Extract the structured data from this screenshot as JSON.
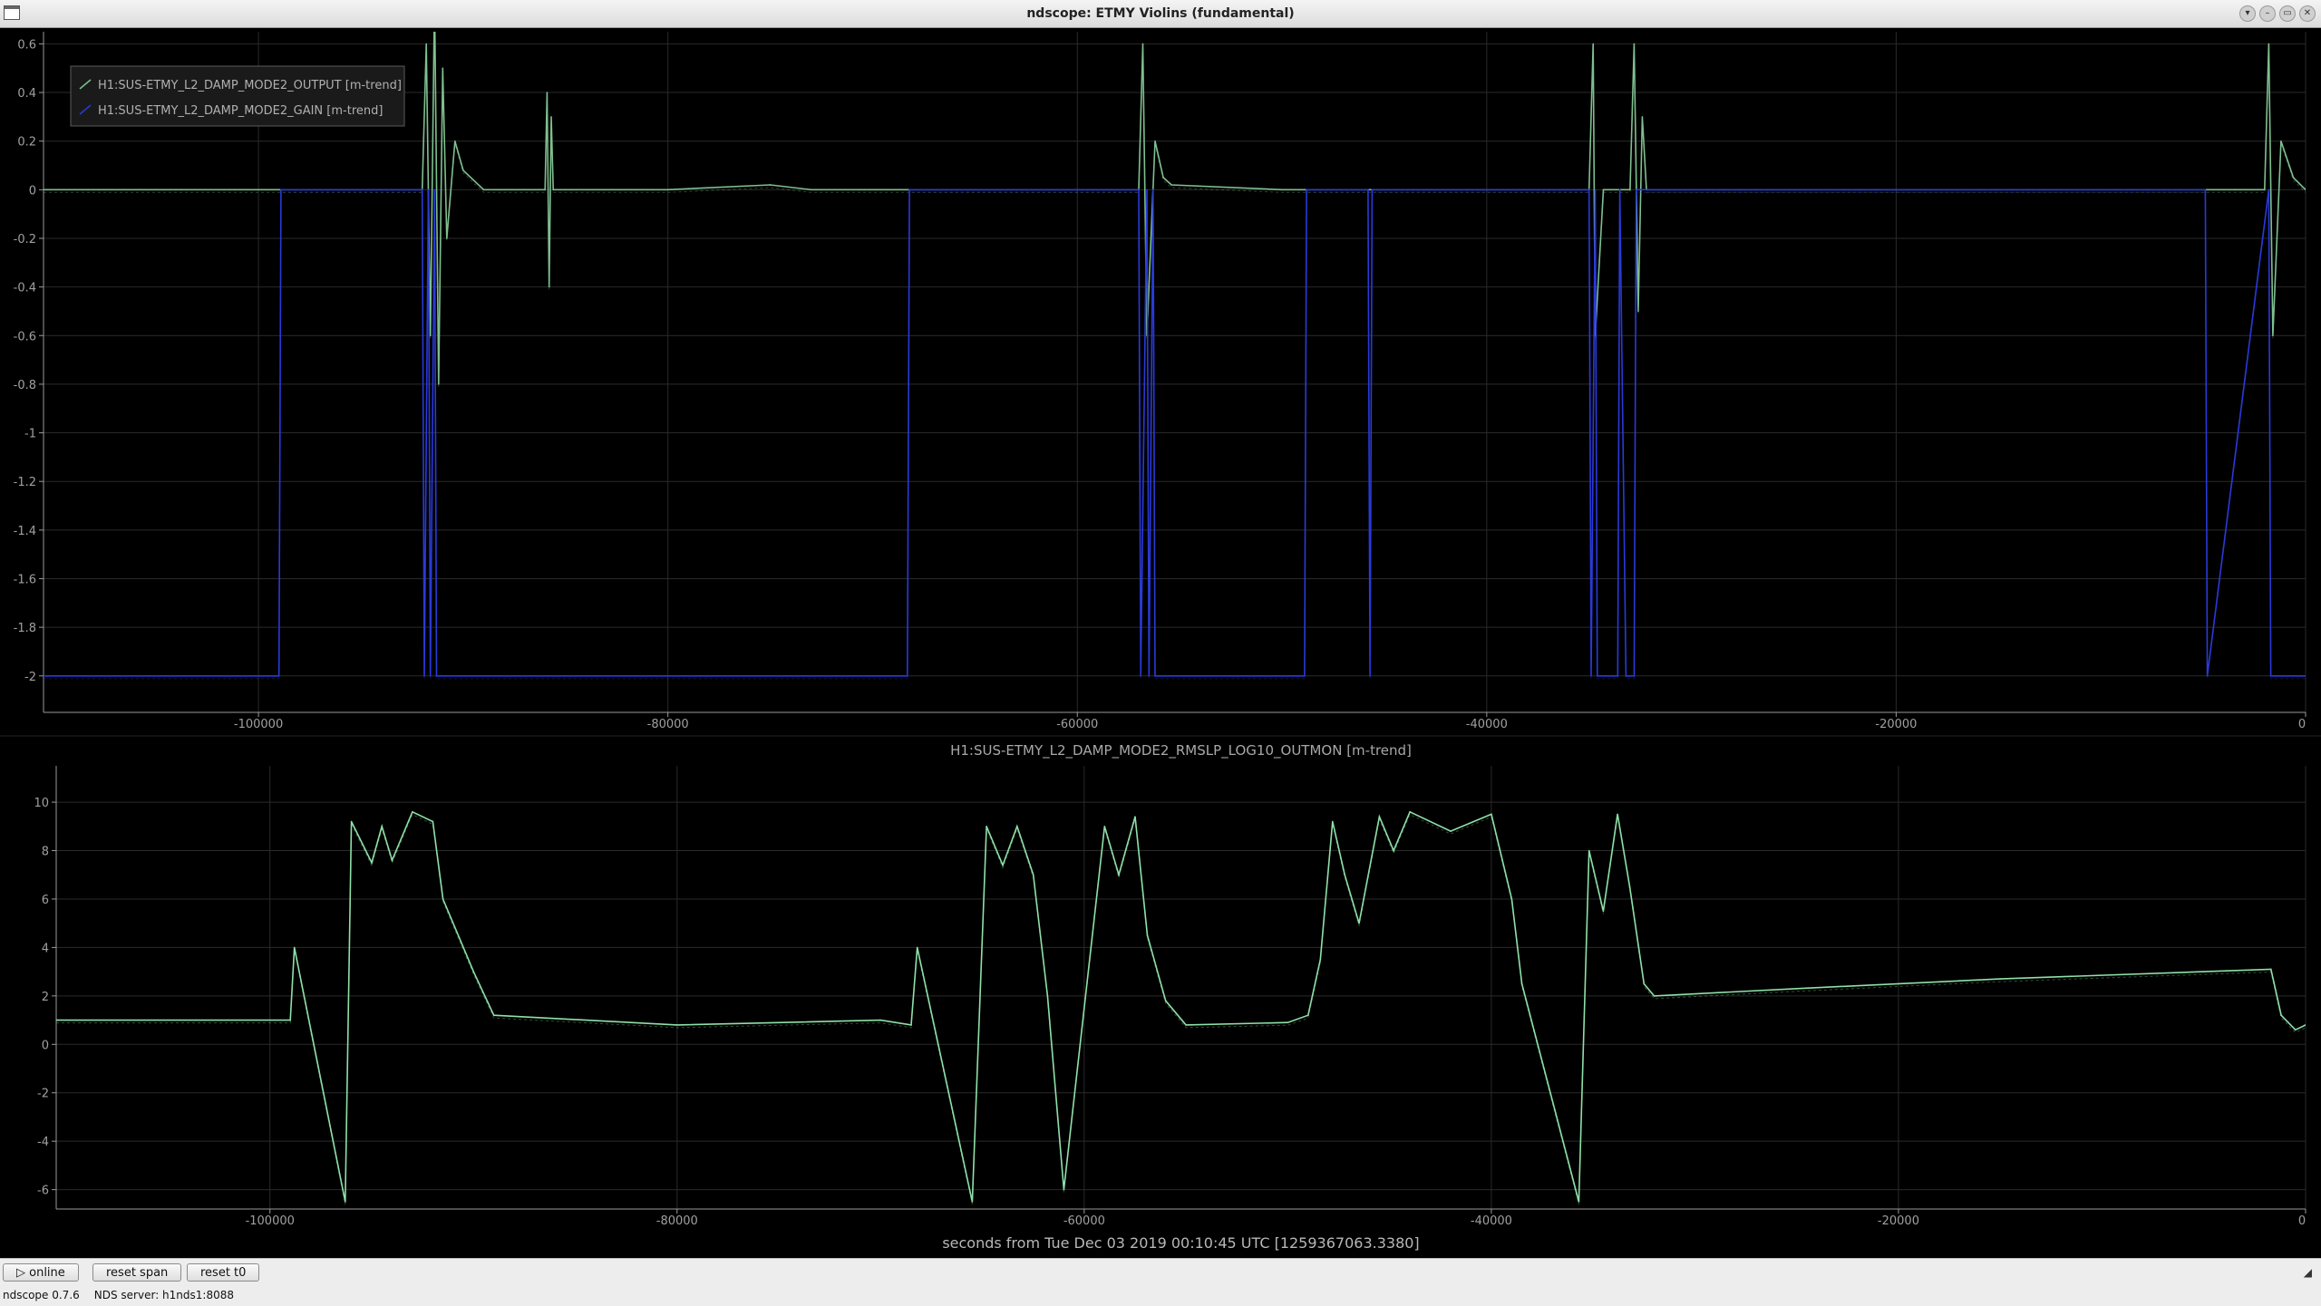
{
  "window": {
    "title": "ndscope: ETMY Violins (fundamental)",
    "buttons": [
      "▾",
      "–",
      "▭",
      "✕"
    ]
  },
  "colors": {
    "background": "#000000",
    "grid": "#2a2a2a",
    "axis": "#9a9a9a",
    "output_trace": "#7fbf8f",
    "gain_trace": "#2a3ad8",
    "outmon_trace": "#8fe0a8"
  },
  "chart_data": [
    {
      "type": "line",
      "title": "",
      "xlabel": "",
      "ylabel": "",
      "xlim": [
        -110500,
        0
      ],
      "ylim": [
        -2.15,
        0.65
      ],
      "xticks": [
        -100000,
        -80000,
        -60000,
        -40000,
        -20000,
        0
      ],
      "yticks": [
        0.6,
        0.4,
        0.2,
        0,
        -0.2,
        -0.4,
        -0.6,
        -0.8,
        -1,
        -1.2,
        -1.4,
        -1.6,
        -1.8,
        -2
      ],
      "grid": true,
      "legend": "top-left",
      "series": [
        {
          "name": "H1:SUS-ETMY_L2_DAMP_MODE2_OUTPUT [m-trend]",
          "color": "#7fbf8f",
          "x": [
            -110500,
            -99000,
            -98900,
            -92000,
            -91800,
            -91600,
            -91400,
            -91200,
            -91000,
            -90800,
            -90400,
            -90000,
            -89000,
            -86000,
            -85900,
            -85800,
            -85700,
            -85600,
            -80000,
            -75000,
            -73000,
            -68500,
            -68400,
            -57000,
            -56800,
            -56600,
            -56200,
            -55800,
            -55400,
            -50000,
            -49100,
            -45800,
            -45600,
            -35000,
            -34800,
            -34700,
            -34300,
            -33000,
            -32800,
            -32600,
            -32400,
            -32200,
            -2000,
            -1800,
            -1600,
            -1200,
            -600,
            0
          ],
          "y": [
            0.0,
            0.0,
            0.0,
            0.0,
            0.6,
            -0.6,
            0.8,
            -0.8,
            0.5,
            -0.2,
            0.2,
            0.08,
            0.0,
            0.0,
            0.4,
            -0.4,
            0.3,
            0.0,
            0.0,
            0.02,
            0.0,
            0.0,
            0.0,
            0.0,
            0.6,
            -0.6,
            0.2,
            0.05,
            0.02,
            0.0,
            0.0,
            0.0,
            0.0,
            0.0,
            0.6,
            -0.6,
            0.0,
            0.0,
            0.6,
            -0.5,
            0.3,
            0.0,
            0.0,
            0.6,
            -0.6,
            0.2,
            0.05,
            0.0
          ]
        },
        {
          "name": "H1:SUS-ETMY_L2_DAMP_MODE2_GAIN [m-trend]",
          "color": "#2a3ad8",
          "x": [
            -110500,
            -99000,
            -98900,
            -92000,
            -91900,
            -91700,
            -91600,
            -91400,
            -91300,
            -91000,
            -90800,
            -68300,
            -68200,
            -57000,
            -56900,
            -56600,
            -56500,
            -56300,
            -56200,
            -48900,
            -48800,
            -45800,
            -45700,
            -45600,
            -35000,
            -34900,
            -34700,
            -34600,
            -33600,
            -33500,
            -33200,
            -32800,
            -32700,
            -4900,
            -4800,
            -1800,
            -1700,
            0
          ],
          "y": [
            -2,
            -2,
            0,
            0,
            -2,
            0,
            -2,
            0,
            -2,
            -2,
            -2,
            -2,
            0,
            0,
            -2,
            0,
            -2,
            0,
            -2,
            -2,
            0,
            0,
            -2,
            0,
            0,
            -2,
            0,
            -2,
            -2,
            0,
            -2,
            -2,
            0,
            0,
            -2,
            0,
            -2,
            -2
          ]
        }
      ]
    },
    {
      "type": "line",
      "title": "H1:SUS-ETMY_L2_DAMP_MODE2_RMSLP_LOG10_OUTMON [m-trend]",
      "xlabel": "seconds from Tue Dec 03 2019 00:10:45 UTC [1259367063.3380]",
      "ylabel": "",
      "xlim": [
        -110500,
        0
      ],
      "ylim": [
        -6.8,
        11.5
      ],
      "xticks": [
        -100000,
        -80000,
        -60000,
        -40000,
        -20000,
        0
      ],
      "yticks": [
        10,
        8,
        6,
        4,
        2,
        0,
        -2,
        -4,
        -6
      ],
      "grid": true,
      "legend": "none",
      "series": [
        {
          "name": "H1:SUS-ETMY_L2_DAMP_MODE2_RMSLP_LOG10_OUTMON [m-trend]",
          "color": "#8fe0a8",
          "x": [
            -110500,
            -99000,
            -98800,
            -96300,
            -96000,
            -95000,
            -94500,
            -94000,
            -93000,
            -92000,
            -91500,
            -90000,
            -89000,
            -80000,
            -70000,
            -68500,
            -68200,
            -65500,
            -64800,
            -64000,
            -63300,
            -62500,
            -61800,
            -61000,
            -59000,
            -58300,
            -57500,
            -56900,
            -56000,
            -55000,
            -50000,
            -49000,
            -48400,
            -47800,
            -47200,
            -46500,
            -45500,
            -44800,
            -44000,
            -42000,
            -40000,
            -39000,
            -38500,
            -35700,
            -35200,
            -34500,
            -33800,
            -33200,
            -32500,
            -32000,
            -25000,
            -15000,
            -5000,
            -1700,
            -1200,
            -500,
            0
          ],
          "y": [
            1.0,
            1.0,
            4.0,
            -6.5,
            9.2,
            7.5,
            9.0,
            7.6,
            9.6,
            9.2,
            6.0,
            3.0,
            1.2,
            0.8,
            1.0,
            0.8,
            4.0,
            -6.5,
            9.0,
            7.4,
            9.0,
            7.0,
            2.0,
            -6.0,
            9.0,
            7.0,
            9.4,
            4.5,
            1.8,
            0.8,
            0.9,
            1.2,
            3.5,
            9.2,
            7.0,
            5.0,
            9.4,
            8.0,
            9.6,
            8.8,
            9.5,
            6.0,
            2.5,
            -6.5,
            8.0,
            5.5,
            9.5,
            6.5,
            2.5,
            2.0,
            2.3,
            2.7,
            3.0,
            3.1,
            1.2,
            0.6,
            0.8
          ]
        }
      ]
    }
  ],
  "toolbar": {
    "online_label": "▷ online",
    "reset_span_label": "reset span",
    "reset_t0_label": "reset t0",
    "handle": "◢"
  },
  "status": {
    "version": "ndscope 0.7.6",
    "server": "NDS server: h1nds1:8088"
  }
}
